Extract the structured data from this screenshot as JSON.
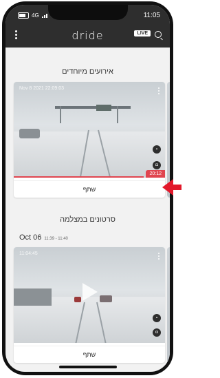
{
  "status": {
    "network": "4G",
    "time": "11:05"
  },
  "header": {
    "brand": "dride",
    "live_label": "LIVE"
  },
  "sections": {
    "events": {
      "title": "אירועים מיוחדים"
    },
    "camera": {
      "title": "סרטונים במצלמה",
      "date": "Oct 06",
      "time_range": "11:39 - 11:40"
    }
  },
  "cards": [
    {
      "timestamp": "Nov 8 2021 22:09:03",
      "duration": "20:12",
      "share_label": "שתף",
      "progress": 0.86
    },
    {
      "timestamp": "11:04:45",
      "share_label": "שתף"
    }
  ],
  "colors": {
    "accent": "#e0454f",
    "arrow": "#e2182a",
    "header_bg": "#2e2e2e"
  }
}
